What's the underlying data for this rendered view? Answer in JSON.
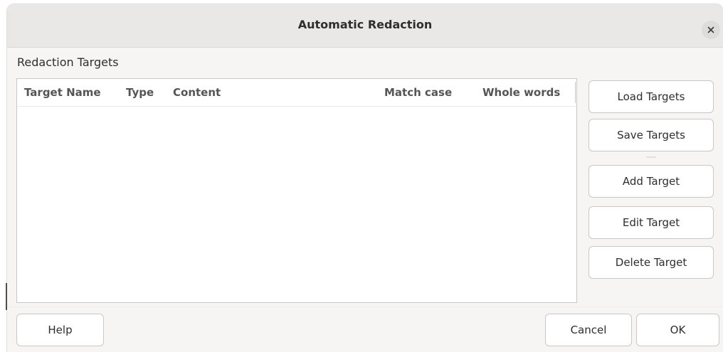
{
  "dialog": {
    "title": "Automatic Redaction",
    "close_icon": "close-icon"
  },
  "targets": {
    "section_label": "Redaction Targets",
    "columns": [
      "Target Name",
      "Type",
      "Content",
      "Match case",
      "Whole words"
    ],
    "rows": []
  },
  "side_buttons": {
    "load": "Load Targets",
    "save": "Save Targets",
    "add": "Add Target",
    "edit": "Edit Target",
    "delete": "Delete Target"
  },
  "footer": {
    "help": "Help",
    "cancel": "Cancel",
    "ok": "OK"
  }
}
